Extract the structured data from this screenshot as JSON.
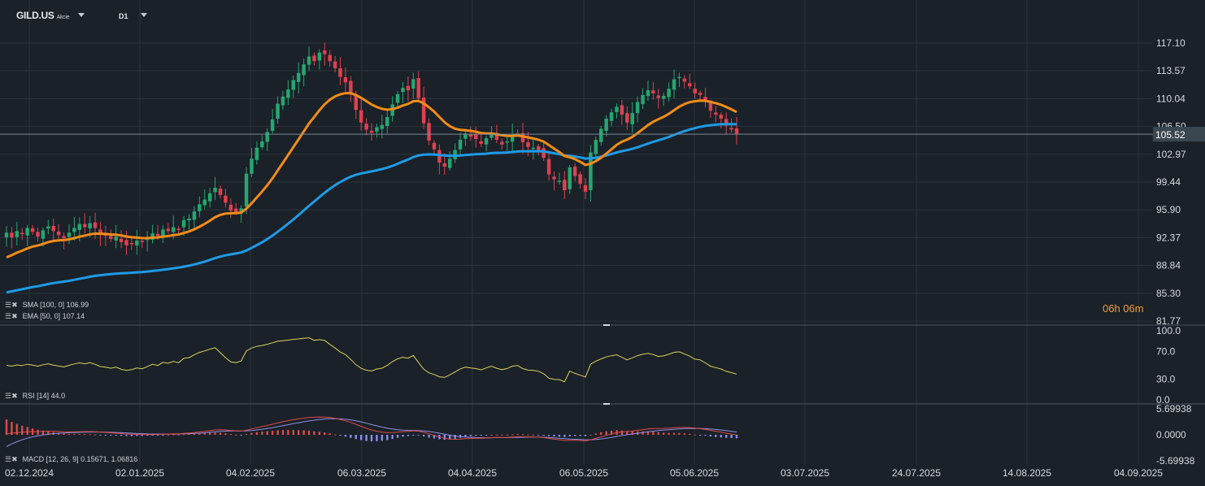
{
  "header": {
    "symbol": "GILD.US",
    "instrument_type": "Akcie",
    "timeframe": "D1"
  },
  "countdown": "06h 06m",
  "last_price_label": "105.52",
  "colors": {
    "background": "#1a2128",
    "grid": "#2a333c",
    "up_candle": "#26a672",
    "down_candle": "#e0404f",
    "sma": "#1e9be6",
    "ema": "#f28c18",
    "rsi": "#dcd25a",
    "macd_line": "#e04a4a",
    "signal_line": "#8f90e6",
    "hist_pos": "#e04a4a",
    "hist_neg": "#8a8ef0",
    "price_line": "#7a8a96",
    "countdown": "#f29d38"
  },
  "indicators": {
    "sma_label": "SMA [100, 0] 106.99",
    "ema_label": "EMA [50, 0] 107.14",
    "rsi_label": "RSI [14] 44.0",
    "macd_label": "MACD [12, 26, 9] 0.15671, 1.06816"
  },
  "chart_data": [
    {
      "type": "candlestick",
      "x_ticks": [
        "02.12.2024",
        "02.01.2025",
        "04.02.2025",
        "06.03.2025",
        "04.04.2025",
        "06.05.2025",
        "05.06.2025",
        "03.07.2025",
        "24.07.2025",
        "14.08.2025",
        "04.09.2025"
      ],
      "y_ticks": [
        "117.10",
        "113.57",
        "110.04",
        "106.50",
        "102.97",
        "99.44",
        "95.90",
        "92.37",
        "88.84",
        "85.30",
        "81.77"
      ],
      "ylim": [
        81.77,
        117.1
      ],
      "last_price": 105.52,
      "closes": [
        93,
        92.4,
        93.2,
        92.8,
        93.6,
        93.1,
        92.5,
        93.3,
        93.8,
        93.2,
        92.7,
        92.3,
        93,
        93.6,
        94.1,
        93.7,
        94.2,
        93.6,
        92.8,
        92.6,
        92.2,
        92.5,
        91.8,
        91.4,
        91.6,
        92,
        91.8,
        92.3,
        92.9,
        92.6,
        93.4,
        93.2,
        93.7,
        93.4,
        94.6,
        94.8,
        95.7,
        96.6,
        97.2,
        98,
        98.7,
        97.8,
        96.8,
        95.8,
        95.6,
        96.1,
        100.5,
        102.4,
        103.8,
        104.6,
        105.8,
        107.4,
        109.4,
        110.3,
        111.2,
        112.4,
        113.3,
        114.4,
        115.4,
        114.8,
        115.9,
        115.7,
        114.8,
        113.9,
        112.8,
        112.1,
        110.6,
        108.6,
        107,
        106.1,
        105.7,
        106.4,
        106.7,
        107.7,
        109.3,
        110.6,
        111.4,
        111.1,
        112.5,
        110.1,
        106.9,
        104.7,
        103.6,
        101.9,
        101.4,
        102.4,
        103.5,
        104.8,
        105.6,
        105.2,
        104.9,
        104.3,
        105,
        105.7,
        104.8,
        104.2,
        104.6,
        105.4,
        105.6,
        104.5,
        103.9,
        103.8,
        103.5,
        102.5,
        100.4,
        99.8,
        99.6,
        98.4,
        101.3,
        100.2,
        99.2,
        98.2,
        103.2,
        104.8,
        106.2,
        107.5,
        108.3,
        109,
        108,
        107,
        108.2,
        109.6,
        110.5,
        111.1,
        110.7,
        110.1,
        110.4,
        111.3,
        112.5,
        112.8,
        112.2,
        111.6,
        110.7,
        110.5,
        109.6,
        108.5,
        108,
        107.5,
        106.6,
        106.1,
        105.5
      ],
      "series": [
        {
          "name": "SMA [100, 0]",
          "last": 106.99
        },
        {
          "name": "EMA [50, 0]",
          "last": 107.14
        }
      ]
    },
    {
      "type": "line",
      "ylim": [
        0,
        100
      ],
      "y_ticks": [
        "100.0",
        "70.0",
        "30.0",
        "0.0"
      ],
      "series": [
        {
          "name": "RSI [14]",
          "last": 44.0
        }
      ]
    },
    {
      "type": "line",
      "ylim": [
        -5.69938,
        5.69938
      ],
      "y_ticks": [
        "5.69938",
        "0.0000",
        "-5.69938"
      ],
      "series": [
        {
          "name": "MACD [12, 26, 9]",
          "last": 0.15671
        },
        {
          "name": "signal",
          "last": 1.06816
        }
      ]
    }
  ]
}
